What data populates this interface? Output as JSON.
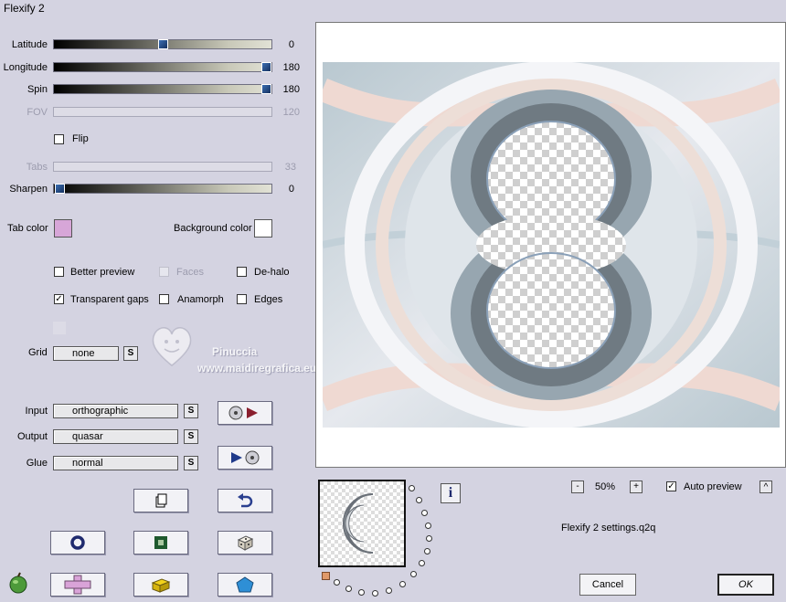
{
  "window": {
    "title": "Flexify 2"
  },
  "sliders": [
    {
      "label": "Latitude",
      "value": "0",
      "level": 0.5,
      "enabled": true
    },
    {
      "label": "Longitude",
      "value": "180",
      "level": 1.0,
      "enabled": true
    },
    {
      "label": "Spin",
      "value": "180",
      "level": 1.0,
      "enabled": true
    },
    {
      "label": "FOV",
      "value": "120",
      "level": 0.5,
      "enabled": false
    },
    {
      "label": "Tabs",
      "value": "33",
      "level": 0.33,
      "enabled": false
    },
    {
      "label": "Sharpen",
      "value": "0",
      "level": 0.0,
      "enabled": true
    }
  ],
  "flip": {
    "label": "Flip",
    "checked": false
  },
  "colors": {
    "tab_label": "Tab color",
    "tab_color": "#d7a6d8",
    "bg_label": "Background color",
    "bg_color": "#ffffff"
  },
  "options": {
    "better_preview": {
      "label": "Better preview",
      "checked": false
    },
    "faces": {
      "label": "Faces",
      "checked": false
    },
    "de_halo": {
      "label": "De-halo",
      "checked": false
    },
    "transparent_gaps": {
      "label": "Transparent gaps",
      "checked": true
    },
    "anamorph": {
      "label": "Anamorph",
      "checked": false
    },
    "edges": {
      "label": "Edges",
      "checked": false
    }
  },
  "grid": {
    "label": "Grid",
    "value": "none"
  },
  "mapping": {
    "input_label": "Input",
    "input_value": "orthographic",
    "output_label": "Output",
    "output_value": "quasar",
    "glue_label": "Glue",
    "glue_value": "normal",
    "s_label": "S"
  },
  "watermark": {
    "name": "Pinuccia",
    "url": "www.maidiregrafica.eu"
  },
  "zoom": {
    "minus": "-",
    "value": "50%",
    "plus": "+"
  },
  "auto_preview": {
    "label": "Auto preview",
    "checked": true
  },
  "arrow_label": "^",
  "info_label": "i",
  "settings_file": "Flexify 2 settings.q2q",
  "buttons": {
    "cancel": "Cancel",
    "ok": "OK"
  },
  "check_mark": "✓"
}
